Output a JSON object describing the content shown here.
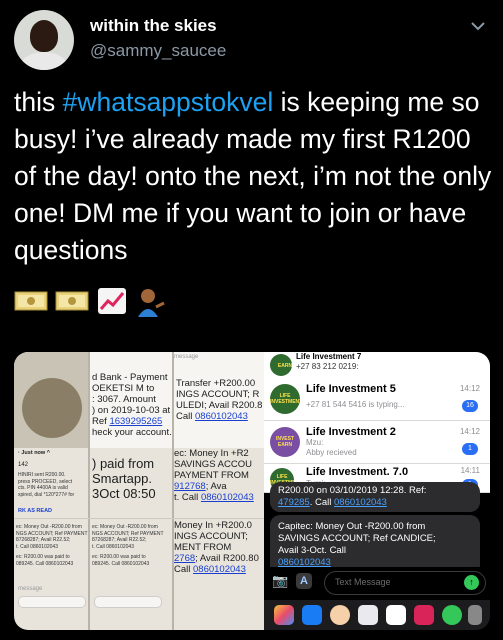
{
  "tweet": {
    "display_name": "within the skies",
    "handle": "@sammy_saucee",
    "text_before": "this ",
    "hashtag": "#whatsappstokvel",
    "text_after": " is keeping me so busy! i’ve already made my first R1200 of the day! onto the next, i’m not the only one! DM me if you want to join or have questions",
    "emojis": [
      "yen-banknote-emoji",
      "yen-banknote-emoji",
      "chart-increasing-emoji",
      "person-tipping-hand-emoji"
    ]
  },
  "image": {
    "left": {
      "bank_header": "d Bank - Payment",
      "bank_l2": "OEKETSI M to",
      "bank_l3": ": 3067. Amount",
      "bank_l4": ") on 2019-10-03 at",
      "bank_l5": "Ref",
      "bank_ref": "1639295265",
      "bank_l6": "heck your account.",
      "transfer_l1": "Transfer +R200.00",
      "transfer_l2": "INGS ACCOUNT; R",
      "transfer_l3": "ULEDI; Avail R200.8",
      "transfer_l4": "Call",
      "transfer_num": "0860102043",
      "message_label": "message",
      "just_now": "· Just now ^",
      "code_142": "142",
      "tiny_l1": "HINIRI sent R200.00.",
      "tiny_l2": "press PROCEED, select",
      "tiny_l3": "cts. PIN 4400A is valid",
      "tiny_l4": "xpired, dial *120*277# for",
      "mark_read": "RK AS READ",
      "paid_from": ") paid from",
      "smartapp": "Smartapp.",
      "date_big": "3Oct 08:50",
      "mid_l1": "ec: Money In +R2",
      "mid_l2": "SAVINGS ACCOU",
      "mid_l3": "PAYMENT FROM",
      "mid_num": "912768",
      "mid_l4": "; Ava",
      "mid_l5": "t. Call",
      "mid_phone": "0860102043",
      "bot_money_in": "Money In +R200.0",
      "bot_l2": "INGS ACCOUNT;",
      "bot_l3": "MENT FROM",
      "bot_num": "2768",
      "bot_l4": "; Avail R200.80",
      "bot_call": "Call",
      "bot_phone": "0860102043",
      "c1_l1": "ec: Money Out -R200.00 from",
      "c1_l2": "NGS ACCOUNT; Ref PAYMENT",
      "c1_l3": "87268287; Avail R22.52;",
      "c1_l4": "t. Call 0860102043",
      "c1_l5": "ec: R200.00 was paid to",
      "c1_l6": "089245. Call 0860102043",
      "c2_l1": "ec: Money Out -R200.00 from",
      "c2_l2": "NGS ACCOUNT; Ref PAYMENT",
      "c2_l3": "87268287; Avail R22.52;",
      "c2_l4": "t. Call 0860102043",
      "c2_l5": "ec: R200.00 was paid to",
      "c2_l6": "089245. Call 0860102043",
      "message_bottom": "message"
    },
    "right": {
      "top_title": "Life Investment 7",
      "top_phone": "+27 83 212 0219:",
      "chats": [
        {
          "title": "Life Investment 5",
          "subtitle": "+27 81 544 5416 is typing...",
          "time": "14:12",
          "badge": "16",
          "thumb": "LIFE INVESTMENT"
        },
        {
          "title": "Life Investment 2",
          "subtitle": "Mzu:",
          "subtitle2": "Abby recieved",
          "time": "14:12",
          "badge": "1",
          "thumb": "INVEST EARN"
        },
        {
          "title": "Life Investment. 7.0",
          "subtitle": "Tumi:",
          "time": "14:11",
          "badge": "1",
          "thumb": "LIFE INVESTMENT"
        }
      ],
      "bubble1_l1": "R200.00 on 03/10/2019 12:28. Ref:",
      "bubble1_ref": "479285",
      "bubble1_l2": ". Call",
      "bubble1_phone": "0860102043",
      "bubble2_l1": "Capitec: Money Out -R200.00 from",
      "bubble2_l2": "SAVINGS ACCOUNT; Ref CANDICE;",
      "bubble2_l3": "Avail                3-Oct. Call",
      "bubble2_phone": "0860102043",
      "placeholder": "Text Message",
      "send_glyph": "↑",
      "camera_glyph": "📷",
      "appstore_glyph": "A"
    }
  },
  "colors": {
    "hashtag": "#1da1f2",
    "handle": "#8b98a5",
    "background": "#000000"
  }
}
